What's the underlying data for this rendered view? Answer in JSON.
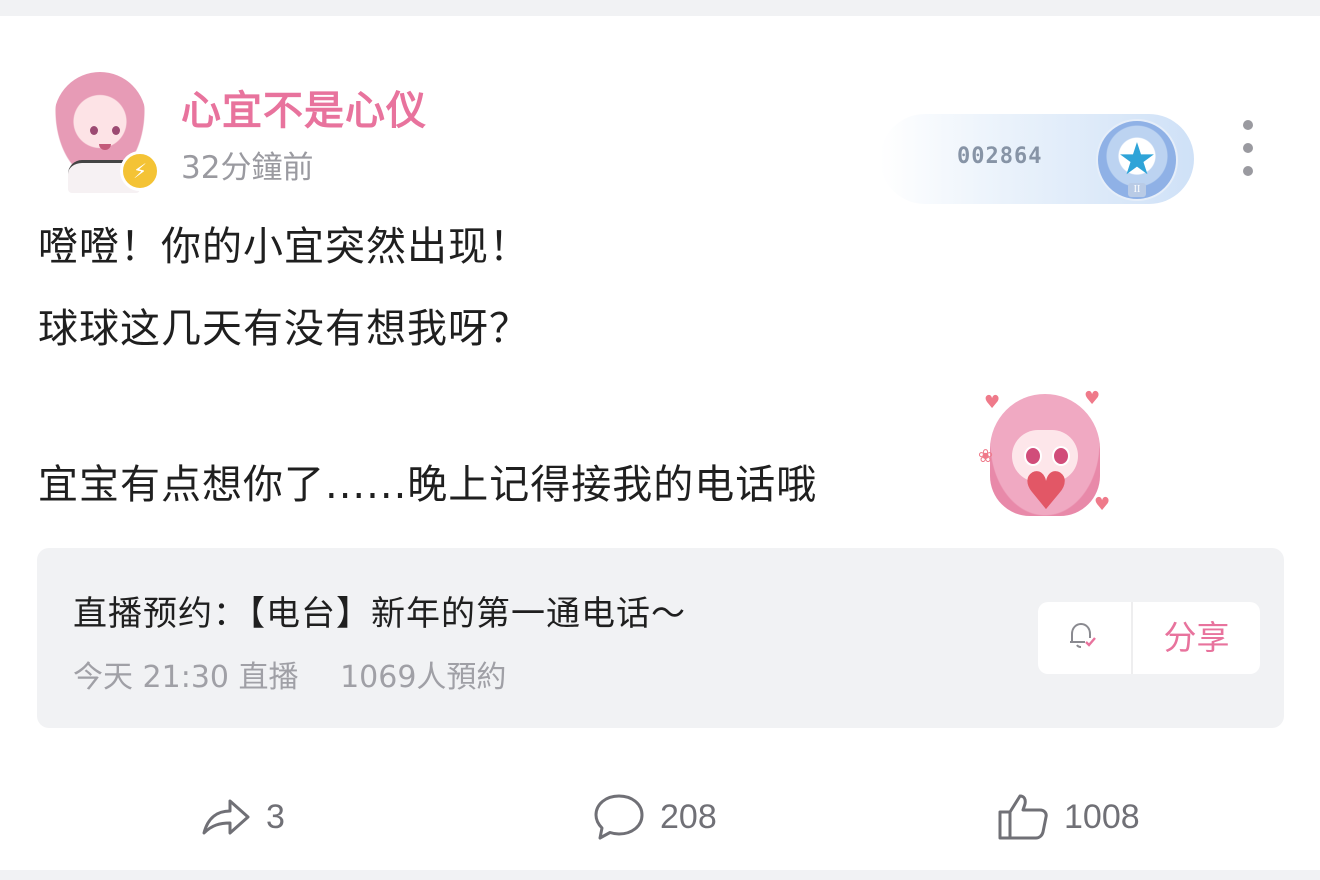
{
  "post": {
    "username": "心宜不是心仪",
    "time": "32分鐘前",
    "fan_badge": {
      "number": "002864",
      "level": "II"
    },
    "lines": [
      "噔噔！你的小宜突然出现！",
      "球球这几天有没有想我呀？",
      "宜宝有点想你了......晚上记得接我的电话哦"
    ],
    "sticker_icon": "pink-hair-girl-heart-sticker"
  },
  "event": {
    "title": "直播预约：【电台】新年的第一通电话～",
    "time": "今天 21:30 直播",
    "reservations": "1069人預約",
    "share_label": "分享"
  },
  "actions": {
    "forward_count": "3",
    "comment_count": "208",
    "like_count": "1008"
  },
  "colors": {
    "username": "#e8739d",
    "share": "#e8739d",
    "badge_accent": "#f4c335"
  }
}
